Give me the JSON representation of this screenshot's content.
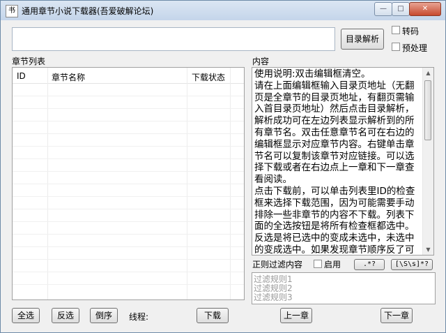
{
  "window": {
    "app_icon": "书",
    "title": "通用章节小说下载器(吾爱破解论坛)",
    "controls": {
      "minimize": "—",
      "maximize": "□",
      "close": "✕"
    }
  },
  "toolbar": {
    "url_value": "",
    "parse_button": "目录解析",
    "transcode_label": "转码",
    "preprocess_label": "预处理"
  },
  "chapter_list": {
    "title": "章节列表",
    "columns": [
      "ID",
      "章节名称",
      "下载状态"
    ]
  },
  "content": {
    "title": "内容",
    "text": "使用说明:双击编辑框清空。\n请在上面编辑框输入目录页地址（无翻页是全章节的目录页地址，有翻页需输入首目录页地址）然后点击目录解析，解析成功可在左边列表显示解析到的所有章节名。双击任意章节名可在右边的编辑框显示对应章节内容。右键单击章节名可以复制该章节对应链接。可以选择下载或者在右边点上一章和下一章查看阅读。\n点击下载前，可以单击列表里ID的检查框来选择下载范围，因为可能需要手动排除一些非章节的内容不下载。列表下面的全选按钮是将所有检查框都选中。反选是将已选中的变成未选中，未选中的变成选中。如果发现章节顺序反了可以点击倒序按钮。"
  },
  "filter": {
    "label": "正则过滤内容",
    "enable_label": "启用",
    "pattern1": ".*?",
    "pattern2": "[\\S\\s]*?",
    "rules": [
      "过滤规则1",
      "过滤规则2",
      "过滤规则3"
    ]
  },
  "bottom": {
    "select_all": "全选",
    "invert": "反选",
    "reverse": "倒序",
    "threads_label": "线程:",
    "download": "下载",
    "prev": "上一章",
    "next": "下一章"
  }
}
